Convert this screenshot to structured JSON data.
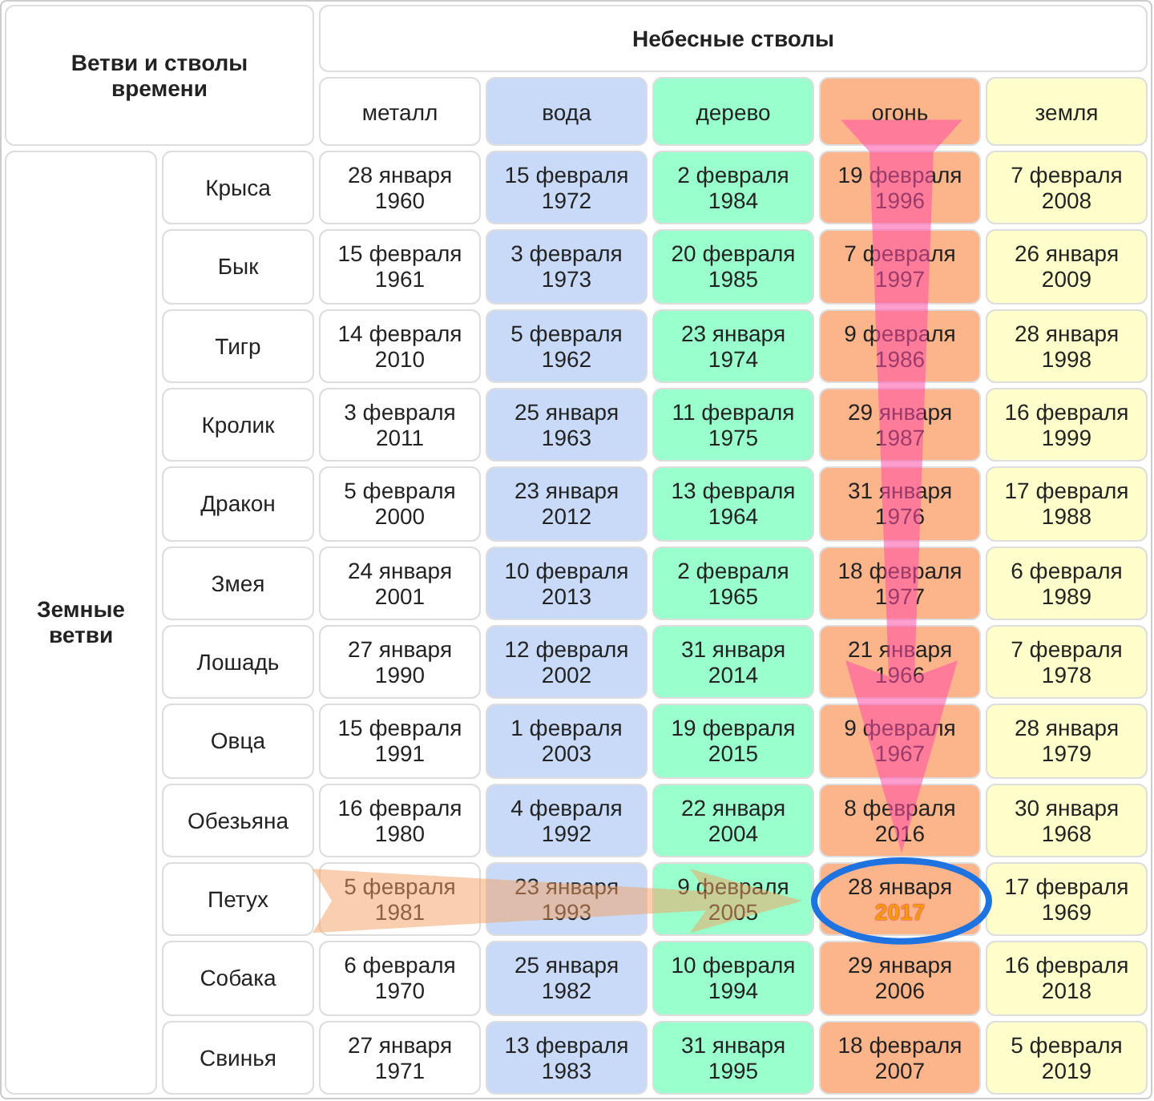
{
  "corner_header": "Ветви и стволы времени",
  "stems_header": "Небесные стволы",
  "branches_header": "Земные ветви",
  "columns": [
    {
      "label": "металл",
      "color": "#ffffff"
    },
    {
      "label": "вода",
      "color": "#c9daf8"
    },
    {
      "label": "дерево",
      "color": "#99ffcc"
    },
    {
      "label": "огонь",
      "color": "#fcb48a"
    },
    {
      "label": "земля",
      "color": "#ffffcc"
    }
  ],
  "rows": [
    {
      "animal": "Крыса",
      "cells": [
        {
          "date": "28 января",
          "year": "1960",
          "highlighted": false
        },
        {
          "date": "15 февраля",
          "year": "1972",
          "highlighted": false
        },
        {
          "date": "2 февраля",
          "year": "1984",
          "highlighted": false
        },
        {
          "date": "19 февраля",
          "year": "1996",
          "highlighted": false
        },
        {
          "date": "7 февраля",
          "year": "2008",
          "highlighted": false
        }
      ]
    },
    {
      "animal": "Бык",
      "cells": [
        {
          "date": "15 февраля",
          "year": "1961",
          "highlighted": false
        },
        {
          "date": "3 февраля",
          "year": "1973",
          "highlighted": false
        },
        {
          "date": "20 февраля",
          "year": "1985",
          "highlighted": false
        },
        {
          "date": "7 февраля",
          "year": "1997",
          "highlighted": false
        },
        {
          "date": "26 января",
          "year": "2009",
          "highlighted": false
        }
      ]
    },
    {
      "animal": "Тигр",
      "cells": [
        {
          "date": "14 февраля",
          "year": "2010",
          "highlighted": false
        },
        {
          "date": "5 февраля",
          "year": "1962",
          "highlighted": false
        },
        {
          "date": "23 января",
          "year": "1974",
          "highlighted": false
        },
        {
          "date": "9 февраля",
          "year": "1986",
          "highlighted": false
        },
        {
          "date": "28 января",
          "year": "1998",
          "highlighted": false
        }
      ]
    },
    {
      "animal": "Кролик",
      "cells": [
        {
          "date": "3 февраля",
          "year": "2011",
          "highlighted": false
        },
        {
          "date": "25 января",
          "year": "1963",
          "highlighted": false
        },
        {
          "date": "11 февраля",
          "year": "1975",
          "highlighted": false
        },
        {
          "date": "29 января",
          "year": "1987",
          "highlighted": false
        },
        {
          "date": "16 февраля",
          "year": "1999",
          "highlighted": false
        }
      ]
    },
    {
      "animal": "Дракон",
      "cells": [
        {
          "date": "5 февраля",
          "year": "2000",
          "highlighted": false
        },
        {
          "date": "23 января",
          "year": "2012",
          "highlighted": false
        },
        {
          "date": "13 февраля",
          "year": "1964",
          "highlighted": false
        },
        {
          "date": "31 января",
          "year": "1976",
          "highlighted": false
        },
        {
          "date": "17 февраля",
          "year": "1988",
          "highlighted": false
        }
      ]
    },
    {
      "animal": "Змея",
      "cells": [
        {
          "date": "24 января",
          "year": "2001",
          "highlighted": false
        },
        {
          "date": "10 февраля",
          "year": "2013",
          "highlighted": false
        },
        {
          "date": "2 февраля",
          "year": "1965",
          "highlighted": false
        },
        {
          "date": "18 февраля",
          "year": "1977",
          "highlighted": false
        },
        {
          "date": "6 февраля",
          "year": "1989",
          "highlighted": false
        }
      ]
    },
    {
      "animal": "Лошадь",
      "cells": [
        {
          "date": "27 января",
          "year": "1990",
          "highlighted": false
        },
        {
          "date": "12 февраля",
          "year": "2002",
          "highlighted": false
        },
        {
          "date": "31 января",
          "year": "2014",
          "highlighted": false
        },
        {
          "date": "21 января",
          "year": "1966",
          "highlighted": false
        },
        {
          "date": "7 февраля",
          "year": "1978",
          "highlighted": false
        }
      ]
    },
    {
      "animal": "Овца",
      "cells": [
        {
          "date": "15 февраля",
          "year": "1991",
          "highlighted": false
        },
        {
          "date": "1 февраля",
          "year": "2003",
          "highlighted": false
        },
        {
          "date": "19 февраля",
          "year": "2015",
          "highlighted": false
        },
        {
          "date": "9 февраля",
          "year": "1967",
          "highlighted": false
        },
        {
          "date": "28 января",
          "year": "1979",
          "highlighted": false
        }
      ]
    },
    {
      "animal": "Обезьяна",
      "cells": [
        {
          "date": "16 февраля",
          "year": "1980",
          "highlighted": false
        },
        {
          "date": "4 февраля",
          "year": "1992",
          "highlighted": false
        },
        {
          "date": "22 января",
          "year": "2004",
          "highlighted": false
        },
        {
          "date": "8 февраля",
          "year": "2016",
          "highlighted": false
        },
        {
          "date": "30 января",
          "year": "1968",
          "highlighted": false
        }
      ]
    },
    {
      "animal": "Петух",
      "cells": [
        {
          "date": "5 февраля",
          "year": "1981",
          "highlighted": false
        },
        {
          "date": "23 января",
          "year": "1993",
          "highlighted": false
        },
        {
          "date": "9 февраля",
          "year": "2005",
          "highlighted": false
        },
        {
          "date": "28 января",
          "year": "2017",
          "highlighted": true
        },
        {
          "date": "17 февраля",
          "year": "1969",
          "highlighted": false
        }
      ]
    },
    {
      "animal": "Собака",
      "cells": [
        {
          "date": "6 февраля",
          "year": "1970",
          "highlighted": false
        },
        {
          "date": "25 января",
          "year": "1982",
          "highlighted": false
        },
        {
          "date": "10 февраля",
          "year": "1994",
          "highlighted": false
        },
        {
          "date": "29 января",
          "year": "2006",
          "highlighted": false
        },
        {
          "date": "16 февраля",
          "year": "2018",
          "highlighted": false
        }
      ]
    },
    {
      "animal": "Свинья",
      "cells": [
        {
          "date": "27 января",
          "year": "1971",
          "highlighted": false
        },
        {
          "date": "13 февраля",
          "year": "1983",
          "highlighted": false
        },
        {
          "date": "31 января",
          "year": "1995",
          "highlighted": false
        },
        {
          "date": "18 февраля",
          "year": "2007",
          "highlighted": false
        },
        {
          "date": "5 февраля",
          "year": "2019",
          "highlighted": false
        }
      ]
    }
  ]
}
